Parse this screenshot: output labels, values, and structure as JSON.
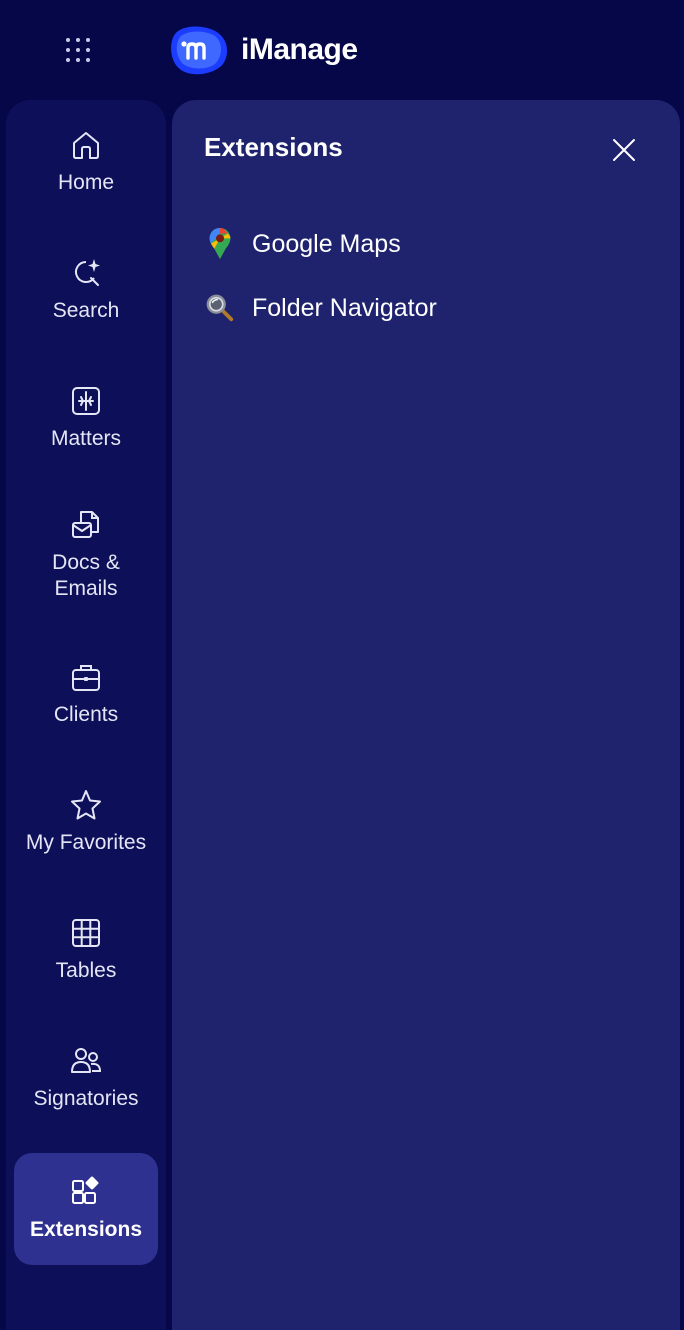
{
  "header": {
    "brand": "iManage",
    "apps_icon": "grid-dots-icon",
    "logo_icon": "imanage-logo-icon"
  },
  "sidebar": {
    "items": [
      {
        "label": "Home",
        "icon": "home-icon",
        "active": false
      },
      {
        "label": "Search",
        "icon": "search-sparkle-icon",
        "active": false
      },
      {
        "label": "Matters",
        "icon": "matters-icon",
        "active": false
      },
      {
        "label": "Docs & Emails",
        "icon": "docs-emails-icon",
        "active": false
      },
      {
        "label": "Clients",
        "icon": "briefcase-icon",
        "active": false
      },
      {
        "label": "My Favorites",
        "icon": "star-icon",
        "active": false
      },
      {
        "label": "Tables",
        "icon": "table-grid-icon",
        "active": false
      },
      {
        "label": "Signatories",
        "icon": "people-icon",
        "active": false
      },
      {
        "label": "Extensions",
        "icon": "extensions-icon",
        "active": true
      }
    ]
  },
  "panel": {
    "title": "Extensions",
    "close_icon": "close-icon",
    "extensions": [
      {
        "label": "Google Maps",
        "icon": "google-maps-pin-icon"
      },
      {
        "label": "Folder Navigator",
        "icon": "magnifier-icon"
      }
    ]
  },
  "colors": {
    "background": "#050749",
    "sidebar": "#0d0f58",
    "panel": "#1f236e",
    "active_item": "#2e3190",
    "logo_blue": "#2563ff"
  }
}
